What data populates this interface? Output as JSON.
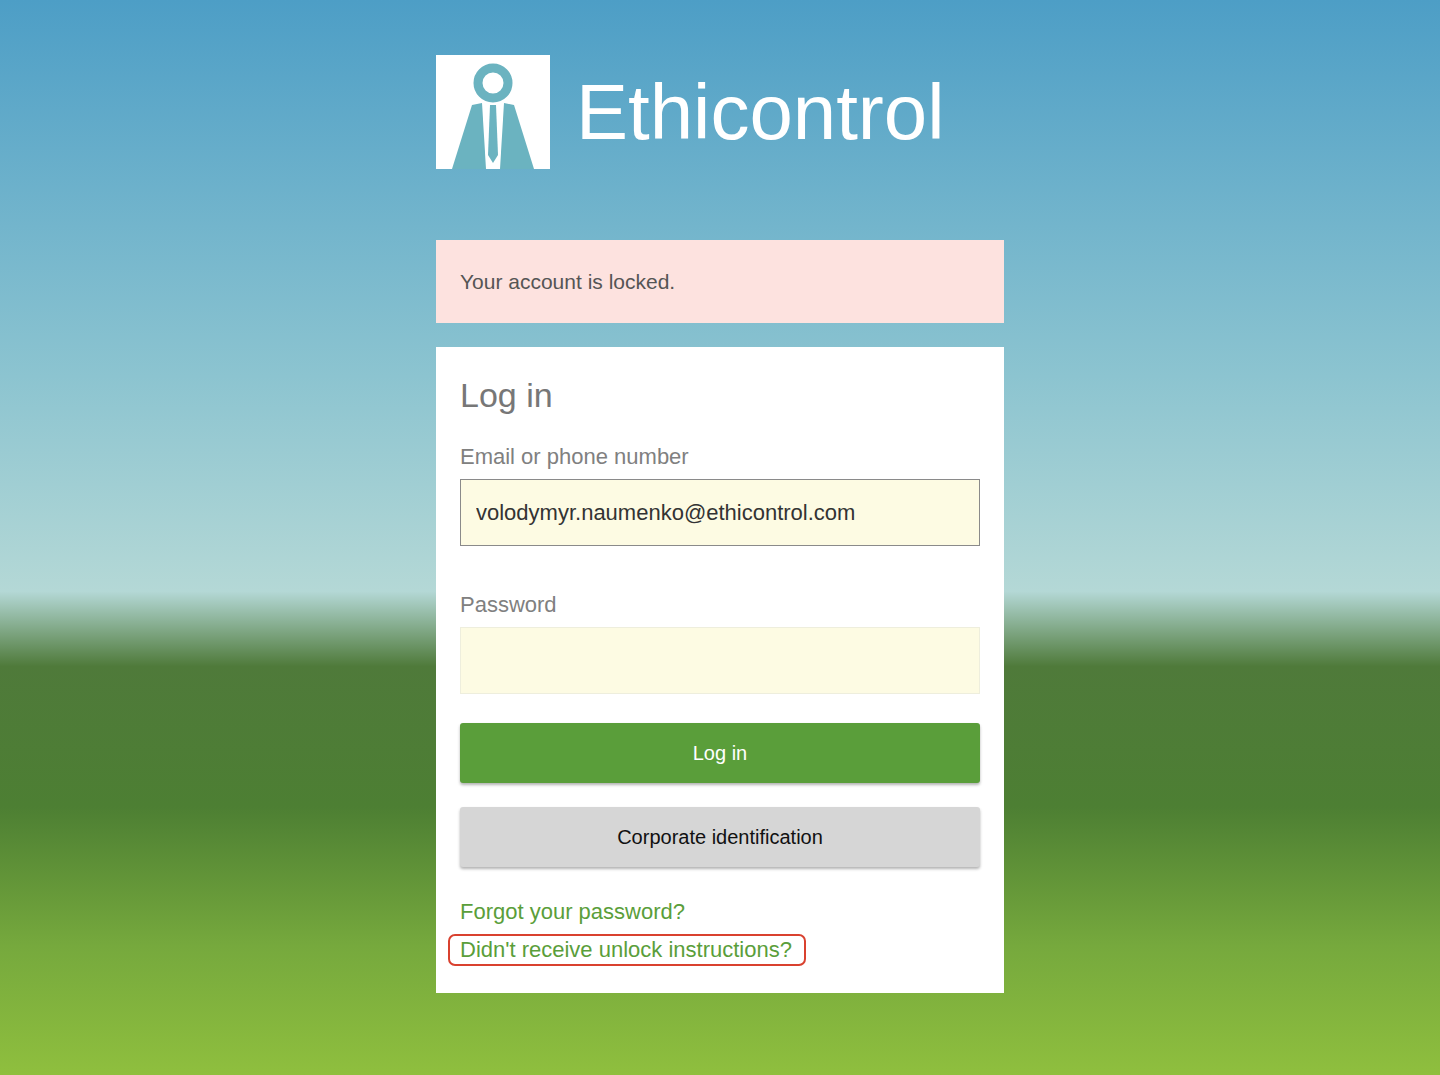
{
  "logo": {
    "text": "Ethicontrol"
  },
  "alert": {
    "text": "Your account is locked."
  },
  "form": {
    "title": "Log in",
    "fields": [
      {
        "label": "Email or phone number",
        "value": "volodymyr.naumenko@ethicontrol.com",
        "focused": true
      },
      {
        "label": "Password",
        "value": "",
        "focused": false
      }
    ],
    "buttons": [
      {
        "label": "Log in",
        "kind": "primary"
      },
      {
        "label": "Corporate identification",
        "kind": "secondary"
      }
    ],
    "links": [
      {
        "label": "Forgot your password?",
        "highlighted": false
      },
      {
        "label": "Didn't receive unlock instructions?",
        "highlighted": true
      }
    ]
  }
}
